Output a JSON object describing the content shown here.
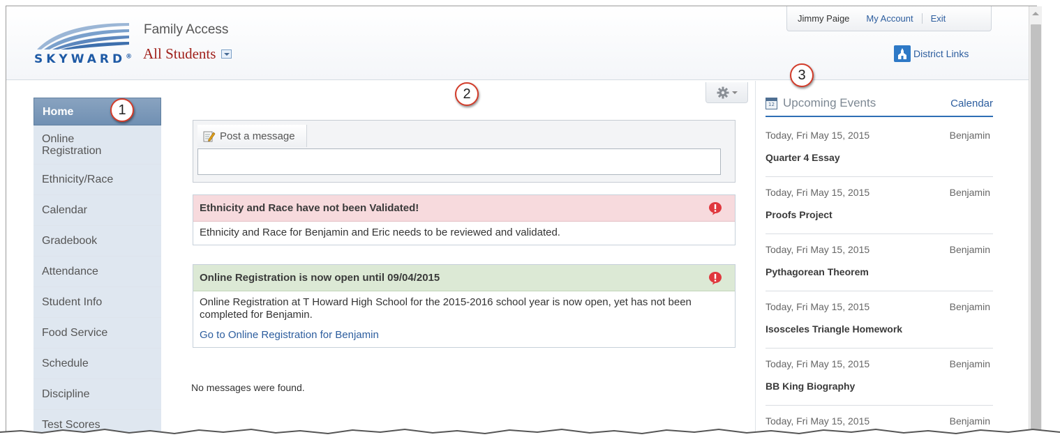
{
  "header": {
    "logo_text": "SKYWARD",
    "logo_mark": "®",
    "product_name": "Family Access",
    "student_selector": "All Students",
    "user_name": "Jimmy Paige",
    "my_account_label": "My Account",
    "exit_label": "Exit",
    "district_links_label": "District Links"
  },
  "sidebar": {
    "items": [
      {
        "label": "Home",
        "active": true
      },
      {
        "label": "Online Registration"
      },
      {
        "label": "Ethnicity/Race"
      },
      {
        "label": "Calendar"
      },
      {
        "label": "Gradebook"
      },
      {
        "label": "Attendance"
      },
      {
        "label": "Student Info"
      },
      {
        "label": "Food Service"
      },
      {
        "label": "Schedule"
      },
      {
        "label": "Discipline"
      },
      {
        "label": "Test Scores"
      }
    ]
  },
  "main": {
    "post_tab_label": "Post a message",
    "alerts": [
      {
        "title": "Ethnicity and Race have not been Validated!",
        "body": "Ethnicity and Race for Benjamin and Eric needs to be reviewed and validated.",
        "color": "#f7dadd"
      },
      {
        "title": "Online Registration is now open until 09/04/2015",
        "body": "Online Registration at T Howard High School for the 2015-2016 school year is now open, yet has not been completed for Benjamin.",
        "link": "Go to Online Registration for Benjamin",
        "color": "#dce9d5"
      }
    ],
    "no_messages_text": "No messages were found."
  },
  "events": {
    "title": "Upcoming Events",
    "calendar_link": "Calendar",
    "calendar_icon_text": "12",
    "items": [
      {
        "date": "Today, Fri May 15, 2015",
        "student": "Benjamin",
        "title": "Quarter 4 Essay"
      },
      {
        "date": "Today, Fri May 15, 2015",
        "student": "Benjamin",
        "title": "Proofs Project"
      },
      {
        "date": "Today, Fri May 15, 2015",
        "student": "Benjamin",
        "title": "Pythagorean Theorem"
      },
      {
        "date": "Today, Fri May 15, 2015",
        "student": "Benjamin",
        "title": "Isosceles Triangle Homework"
      },
      {
        "date": "Today, Fri May 15, 2015",
        "student": "Benjamin",
        "title": "BB King Biography"
      },
      {
        "date": "Today, Fri May 15, 2015",
        "student": "Benjamin",
        "title": ""
      }
    ]
  },
  "callouts": [
    "1",
    "2",
    "3"
  ],
  "colors": {
    "accent": "#2c5d9e",
    "nav_active": "#7a97b8",
    "callout_border": "#d33c2a",
    "alert_icon": "#e0383e"
  }
}
